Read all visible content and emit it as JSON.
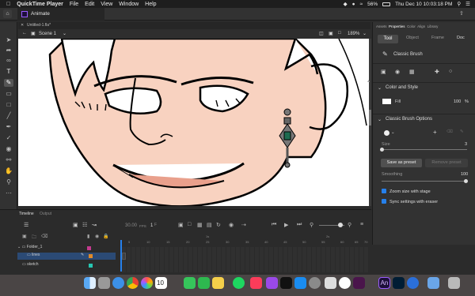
{
  "menubar": {
    "app_name": "QuickTime Player",
    "items": [
      "File",
      "Edit",
      "View",
      "Window",
      "Help"
    ],
    "battery": "56%",
    "datetime": "Thu Dec 10  10:03:18 PM"
  },
  "app_tab": {
    "label": "Animate"
  },
  "document": {
    "tab_label": "Untitled-1.fla*",
    "scene": "Scene 1",
    "zoom": "189%"
  },
  "panel": {
    "top_tabs": [
      "Assets",
      "Properties",
      "Color",
      "Align",
      "Library"
    ],
    "sub_tabs": [
      "Tool",
      "Object",
      "Frame",
      "Doc"
    ],
    "tool_name": "Classic Brush",
    "color_style": {
      "title": "Color and Style",
      "fill_label": "Fill",
      "fill_percent": "100",
      "percent_sign": "%"
    },
    "brush_options": {
      "title": "Classic Brush Options",
      "size_label": "Size",
      "size_value": "3",
      "save_preset": "Save as preset",
      "remove_preset": "Remove preset",
      "smoothing_label": "Smoothing",
      "smoothing_value": "100",
      "zoom_with_stage": "Zoom size with stage",
      "sync_with_eraser": "Sync settings with eraser"
    }
  },
  "timeline": {
    "tabs": [
      "Timeline",
      "Output"
    ],
    "fps": "30.00",
    "fps_unit": "FPS",
    "frame": "1",
    "layers": [
      {
        "name": "Folder_1"
      },
      {
        "name": "lines"
      },
      {
        "name": "sketch"
      }
    ],
    "ruler_labels": [
      "5",
      "10",
      "15",
      "20",
      "25",
      "30",
      "35",
      "40",
      "45",
      "50",
      "55",
      "60",
      "65",
      "70"
    ],
    "time_markers": [
      "1s",
      "2s"
    ]
  },
  "dock": {
    "calendar_day": "10"
  },
  "colors": {
    "accent": "#2680eb",
    "skin": "#f8d2c0",
    "layer_selected": "#2b4a75",
    "frame_orange": "#e08a28"
  }
}
